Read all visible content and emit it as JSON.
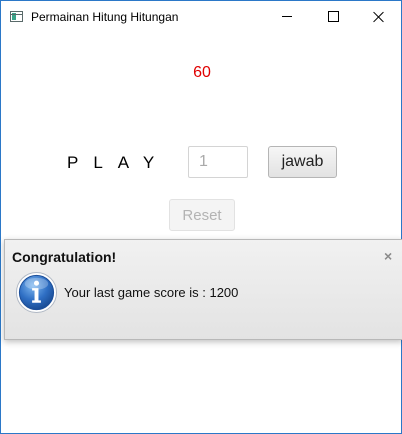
{
  "window": {
    "title": "Permainan Hitung Hitungan",
    "controls": {
      "minimize": "minimize",
      "maximize": "maximize",
      "close": "close"
    }
  },
  "game": {
    "timer_value": "60",
    "timer_color": "#e00000",
    "play_label": "PLAY",
    "answer_placeholder": "1",
    "jawab_label": "jawab",
    "reset_label": "Reset"
  },
  "dialog": {
    "header": "Congratulation!",
    "close_glyph": "×",
    "icon": "info-icon",
    "message": "Your last game score is : 1200"
  }
}
